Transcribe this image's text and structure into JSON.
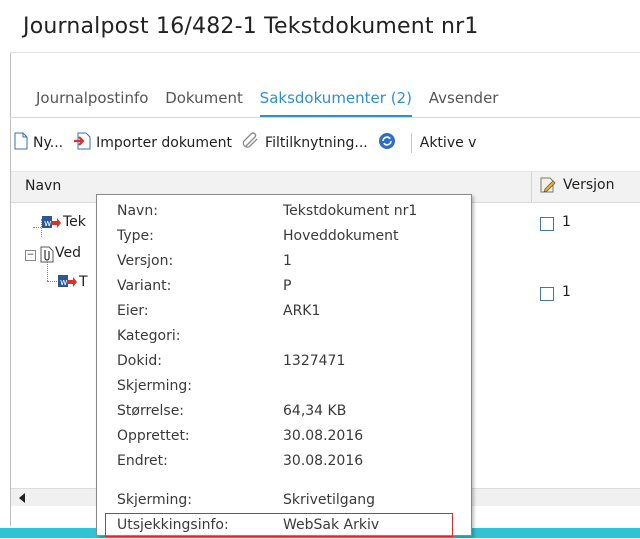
{
  "title": "Journalpost 16/482-1 Tekstdokument nr1",
  "tabs": [
    "Journalpostinfo",
    "Dokument",
    "Saksdokumenter (2)",
    "Avsender"
  ],
  "toolbar": {
    "new": "Ny...",
    "import": "Importer dokument",
    "link": "Filtilknytning...",
    "active": "Aktive v"
  },
  "grid": {
    "col_name": "Navn",
    "col_version": "Versjon",
    "rows": [
      {
        "text": "Tek",
        "version": "1"
      },
      {
        "text": "Ved",
        "version": ""
      },
      {
        "text": "T",
        "version": "1"
      }
    ]
  },
  "tooltip": {
    "rows": [
      {
        "key": "Navn:",
        "value": "Tekstdokument nr1"
      },
      {
        "key": "Type:",
        "value": "Hoveddokument"
      },
      {
        "key": "Versjon:",
        "value": "1"
      },
      {
        "key": "Variant:",
        "value": "P"
      },
      {
        "key": "Eier:",
        "value": "ARK1"
      },
      {
        "key": "Kategori:",
        "value": ""
      },
      {
        "key": "Dokid:",
        "value": "1327471"
      },
      {
        "key": "Skjerming:",
        "value": ""
      },
      {
        "key": "Størrelse:",
        "value": "64,34 KB"
      },
      {
        "key": "Opprettet:",
        "value": "30.08.2016"
      },
      {
        "key": "Endret:",
        "value": "30.08.2016"
      },
      {
        "key": "Skjerming:",
        "value": "Skrivetilgang"
      },
      {
        "key": "Utsjekkingsinfo:",
        "value": "WebSak Arkiv"
      }
    ]
  },
  "colors": {
    "accent": "#2e8fd9",
    "highlight": "#e0262a",
    "band": "#2ec4d6"
  }
}
